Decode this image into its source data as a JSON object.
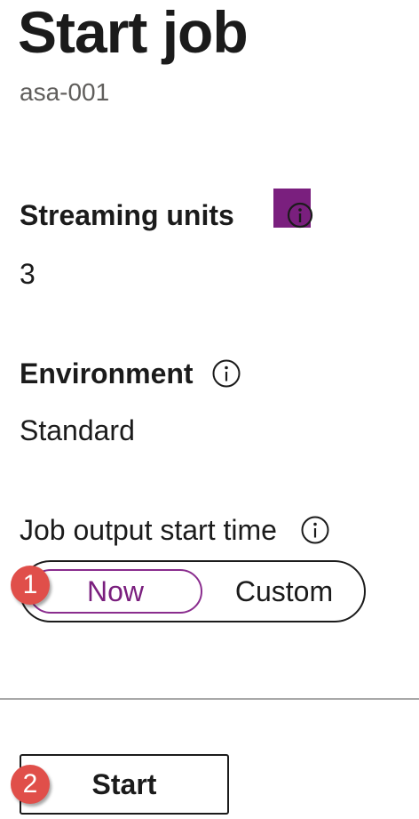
{
  "header": {
    "title": "Start job",
    "subtitle": "asa-001"
  },
  "fields": {
    "streaming_units": {
      "label": "Streaming units",
      "value": "3",
      "info_icon": "info-icon",
      "highlight_color": "#7a1f7e"
    },
    "environment": {
      "label": "Environment",
      "value": "Standard",
      "info_icon": "info-icon"
    },
    "job_output_start_time": {
      "label": "Job output start time",
      "info_icon": "info-icon",
      "options": [
        "Now",
        "Custom"
      ],
      "selected": "Now",
      "selected_color": "#7a1f7e"
    }
  },
  "actions": {
    "start_label": "Start"
  },
  "callouts": {
    "step1": "1",
    "step2": "2",
    "badge_color": "#e04f4a"
  }
}
